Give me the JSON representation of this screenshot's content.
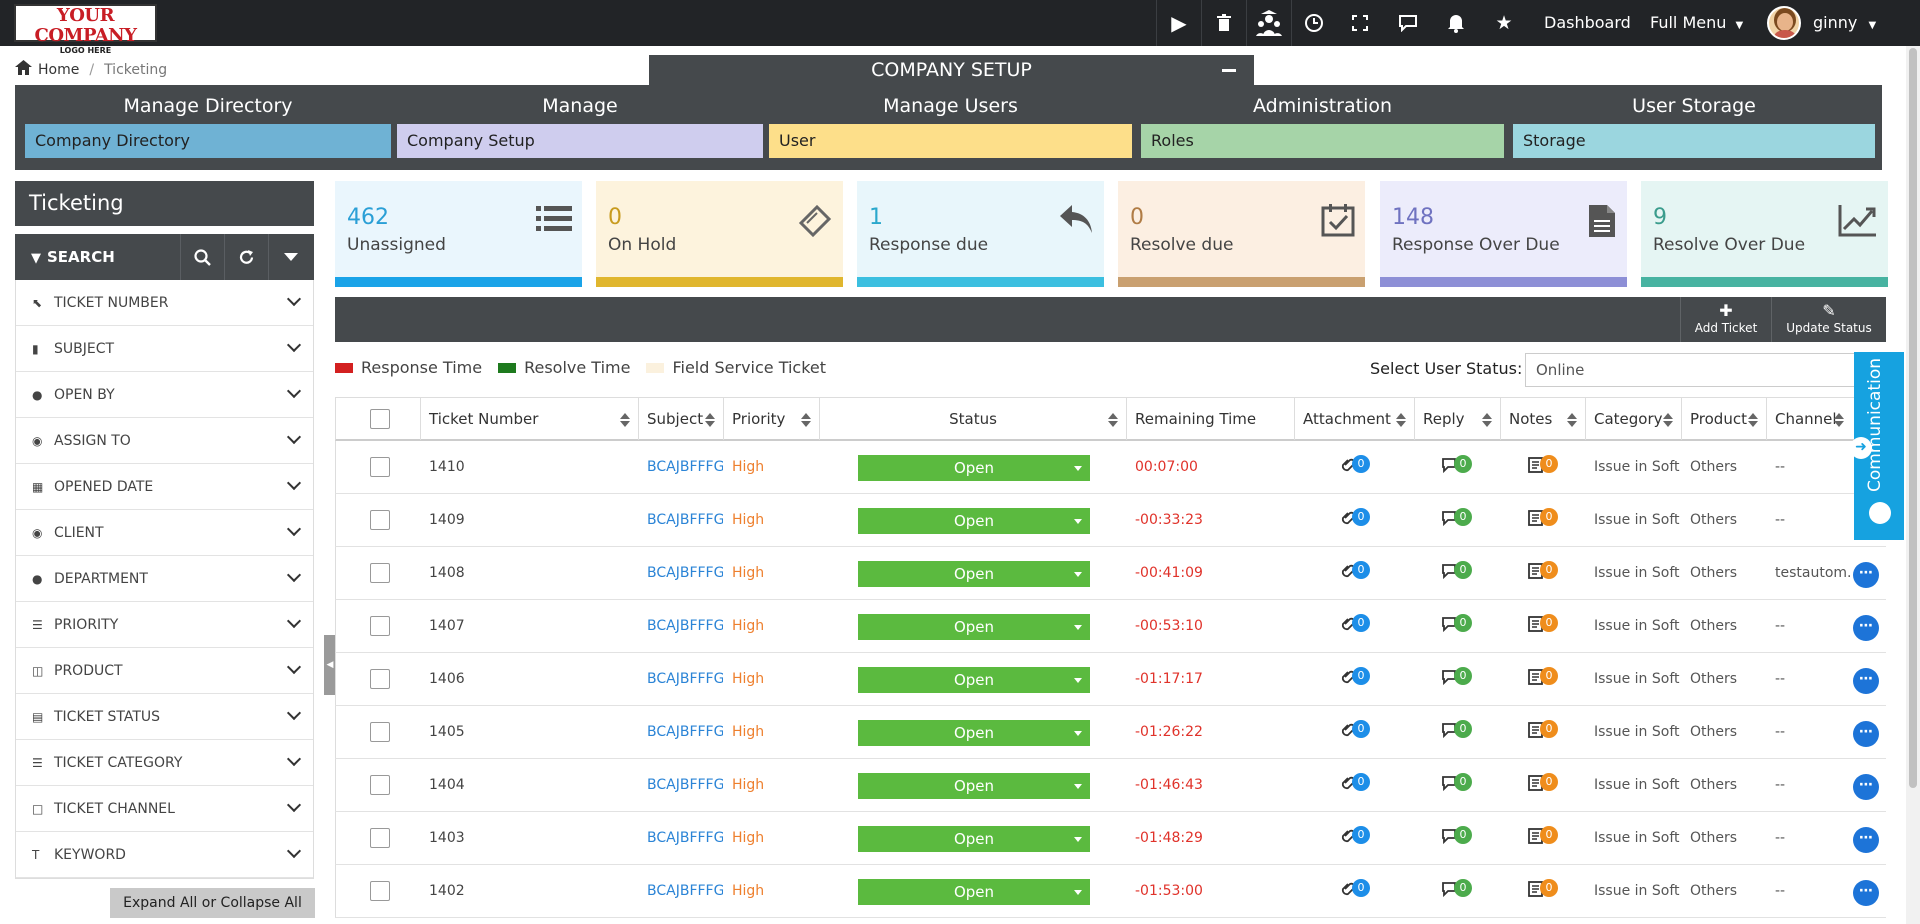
{
  "brand": {
    "logo_line1": "YOUR COMPANY",
    "logo_line2": "LOGO HERE"
  },
  "topbar": {
    "icons": [
      "play-icon",
      "trash-icon",
      "team-icon",
      "clock-icon",
      "fullscreen-icon",
      "chat-icon",
      "bell-icon",
      "star-icon"
    ],
    "dashboard": "Dashboard",
    "full_menu": "Full Menu",
    "user": "ginny"
  },
  "breadcrumb": {
    "home": "Home",
    "current": "Ticketing"
  },
  "company_setup": {
    "title": "COMPANY SETUP",
    "columns": [
      {
        "heading": "Manage Directory",
        "button": "Company Directory",
        "color": "#6fb2d4"
      },
      {
        "heading": "Manage",
        "button": "Company Setup",
        "color": "#cfcdee"
      },
      {
        "heading": "Manage Users",
        "button": "User",
        "color": "#fddf8a"
      },
      {
        "heading": "Administration",
        "button": "Roles",
        "color": "#a6d4a8"
      },
      {
        "heading": "User Storage",
        "button": "Storage",
        "color": "#9bd6df"
      }
    ]
  },
  "sidebar": {
    "title": "Ticketing",
    "search_label": "SEARCH",
    "filters": [
      "TICKET NUMBER",
      "SUBJECT",
      "OPEN BY",
      "ASSIGN TO",
      "OPENED DATE",
      "CLIENT",
      "DEPARTMENT",
      "PRIORITY",
      "PRODUCT",
      "TICKET STATUS",
      "TICKET CATEGORY",
      "TICKET CHANNEL",
      "KEYWORD"
    ],
    "expand_label": "Expand All or Collapse All"
  },
  "stats": [
    {
      "value": "462",
      "label": "Unassigned",
      "bg": "#eaf6fd",
      "bar": "#1aa3e8",
      "num_color": "#2a9fd6",
      "icon": "list-icon"
    },
    {
      "value": "0",
      "label": "On Hold",
      "bg": "#fdf3dd",
      "bar": "#e0b62e",
      "num_color": "#c89b1f",
      "icon": "ticket-icon"
    },
    {
      "value": "1",
      "label": "Response due",
      "bg": "#e8f6fb",
      "bar": "#3bbfe0",
      "num_color": "#2aa8cc",
      "icon": "reply-icon"
    },
    {
      "value": "0",
      "label": "Resolve due",
      "bg": "#fcefe2",
      "bar": "#c9a070",
      "num_color": "#b07c45",
      "icon": "calendar-check-icon"
    },
    {
      "value": "148",
      "label": "Response Over Due",
      "bg": "#ececfb",
      "bar": "#8d8fd6",
      "num_color": "#6f72c0",
      "icon": "document-icon"
    },
    {
      "value": "9",
      "label": "Resolve Over Due",
      "bg": "#e5f5f3",
      "bar": "#47b3a1",
      "num_color": "#3a9c8c",
      "icon": "chart-line-icon"
    }
  ],
  "actions": {
    "add_ticket": "Add Ticket",
    "update_status": "Update Status"
  },
  "legend": [
    {
      "label": "Response Time",
      "color": "#d32020"
    },
    {
      "label": "Resolve Time",
      "color": "#1e7a1e"
    },
    {
      "label": "Field Service Ticket",
      "color": "#fbf1de"
    }
  ],
  "user_status": {
    "label": "Select User Status:",
    "value": "Online"
  },
  "table": {
    "headers": [
      "Ticket Number",
      "Subject",
      "Priority",
      "Status",
      "Remaining Time",
      "Attachment",
      "Reply",
      "Notes",
      "Category",
      "Product",
      "Channel"
    ],
    "rows": [
      {
        "number": "1410",
        "subject": "BCAJBFFFG",
        "priority": "High",
        "status": "Open",
        "remaining": "00:07:00",
        "att": "0",
        "reply": "0",
        "notes": "0",
        "category": "Issue in Soft...",
        "product": "Others",
        "channel": "--"
      },
      {
        "number": "1409",
        "subject": "BCAJBFFFG",
        "priority": "High",
        "status": "Open",
        "remaining": "-00:33:23",
        "att": "0",
        "reply": "0",
        "notes": "0",
        "category": "Issue in Soft...",
        "product": "Others",
        "channel": "--"
      },
      {
        "number": "1408",
        "subject": "BCAJBFFFG",
        "priority": "High",
        "status": "Open",
        "remaining": "-00:41:09",
        "att": "0",
        "reply": "0",
        "notes": "0",
        "category": "Issue in Soft...",
        "product": "Others",
        "channel": "testautom..."
      },
      {
        "number": "1407",
        "subject": "BCAJBFFFG",
        "priority": "High",
        "status": "Open",
        "remaining": "-00:53:10",
        "att": "0",
        "reply": "0",
        "notes": "0",
        "category": "Issue in Soft...",
        "product": "Others",
        "channel": "--"
      },
      {
        "number": "1406",
        "subject": "BCAJBFFFG",
        "priority": "High",
        "status": "Open",
        "remaining": "-01:17:17",
        "att": "0",
        "reply": "0",
        "notes": "0",
        "category": "Issue in Soft...",
        "product": "Others",
        "channel": "--"
      },
      {
        "number": "1405",
        "subject": "BCAJBFFFG",
        "priority": "High",
        "status": "Open",
        "remaining": "-01:26:22",
        "att": "0",
        "reply": "0",
        "notes": "0",
        "category": "Issue in Soft...",
        "product": "Others",
        "channel": "--"
      },
      {
        "number": "1404",
        "subject": "BCAJBFFFG",
        "priority": "High",
        "status": "Open",
        "remaining": "-01:46:43",
        "att": "0",
        "reply": "0",
        "notes": "0",
        "category": "Issue in Soft...",
        "product": "Others",
        "channel": "--"
      },
      {
        "number": "1403",
        "subject": "BCAJBFFFG",
        "priority": "High",
        "status": "Open",
        "remaining": "-01:48:29",
        "att": "0",
        "reply": "0",
        "notes": "0",
        "category": "Issue in Soft...",
        "product": "Others",
        "channel": "--"
      },
      {
        "number": "1402",
        "subject": "BCAJBFFFG",
        "priority": "High",
        "status": "Open",
        "remaining": "-01:53:00",
        "att": "0",
        "reply": "0",
        "notes": "0",
        "category": "Issue in Soft...",
        "product": "Others",
        "channel": "--"
      }
    ]
  },
  "communication": {
    "label": "Communication"
  }
}
